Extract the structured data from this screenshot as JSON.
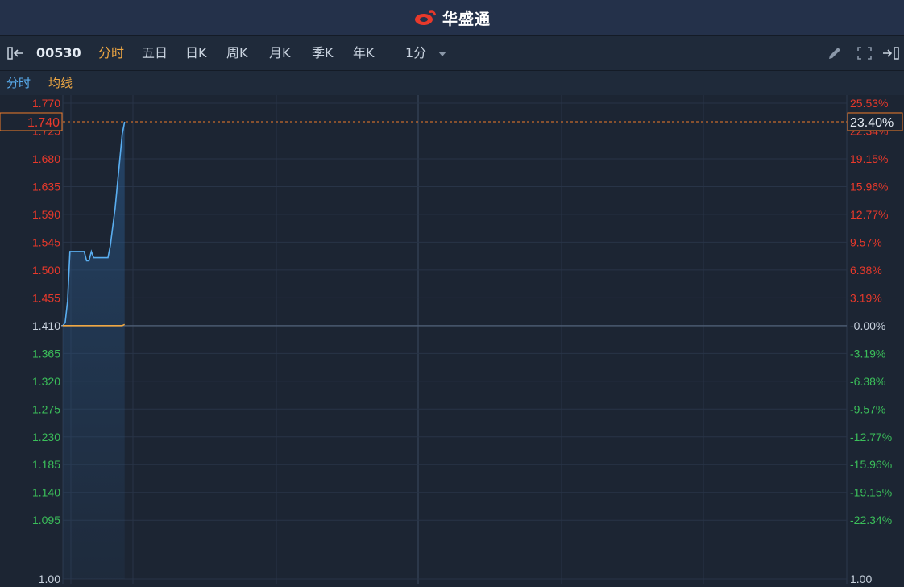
{
  "header": {
    "brand": "华盛通",
    "brand_color": "#e8392b"
  },
  "toolbar": {
    "code": "00530",
    "tabs": [
      "分时",
      "五日",
      "日K",
      "周K",
      "月K",
      "季K",
      "年K"
    ],
    "active_tab": "分时",
    "interval": "1分",
    "icons": [
      "collapse-left-icon",
      "dropdown-arrow-icon",
      "pencil-icon",
      "fullscreen-icon",
      "collapse-right-icon"
    ]
  },
  "subbar": {
    "price_label": "分时",
    "avg_label": "均线"
  },
  "colors": {
    "up": "#e8392b",
    "down": "#3bbf5a",
    "neutral": "#c9d3df",
    "price_line": "#5aaef0",
    "avg_line": "#f0a843",
    "marker": "#f07c2a",
    "active": "#f0a843"
  },
  "chart_data": {
    "type": "line",
    "prev_close": 1.41,
    "ylim": [
      1.0,
      1.77
    ],
    "current_price": "1.740",
    "current_pct": "23.40%",
    "y_ticks_left": [
      "1.770",
      "1.725",
      "1.680",
      "1.635",
      "1.590",
      "1.545",
      "1.500",
      "1.455",
      "1.410",
      "1.365",
      "1.320",
      "1.275",
      "1.230",
      "1.185",
      "1.140",
      "1.095",
      "1.00"
    ],
    "y_ticks_right": [
      "25.53%",
      "22.34%",
      "19.15%",
      "15.96%",
      "12.77%",
      "9.57%",
      "6.38%",
      "3.19%",
      "-0.00%",
      "-3.19%",
      "-6.38%",
      "-9.57%",
      "-12.77%",
      "-15.96%",
      "-19.15%",
      "-22.34%",
      "1.00"
    ],
    "tick_values": [
      1.77,
      1.725,
      1.68,
      1.635,
      1.59,
      1.545,
      1.5,
      1.455,
      1.41,
      1.365,
      1.32,
      1.275,
      1.23,
      1.185,
      1.14,
      1.095,
      1.0
    ],
    "total_minutes": 330,
    "series": [
      {
        "x": [
          0,
          1,
          2,
          3,
          4,
          5,
          6,
          7,
          8,
          9,
          10,
          11,
          12,
          13,
          14,
          15,
          16,
          17,
          18,
          19,
          20,
          21,
          22,
          23,
          24,
          25,
          26
        ],
        "values": [
          1.41,
          1.415,
          1.45,
          1.53,
          1.53,
          1.53,
          1.53,
          1.53,
          1.53,
          1.53,
          1.515,
          1.515,
          1.53,
          1.52,
          1.52,
          1.52,
          1.52,
          1.52,
          1.52,
          1.52,
          1.54,
          1.57,
          1.6,
          1.64,
          1.68,
          1.72,
          1.74
        ]
      },
      {
        "x": [
          0,
          5,
          10,
          15,
          20,
          25,
          26
        ],
        "values": [
          1.41,
          1.41,
          1.41,
          1.41,
          1.41,
          1.41,
          1.412
        ]
      }
    ]
  }
}
